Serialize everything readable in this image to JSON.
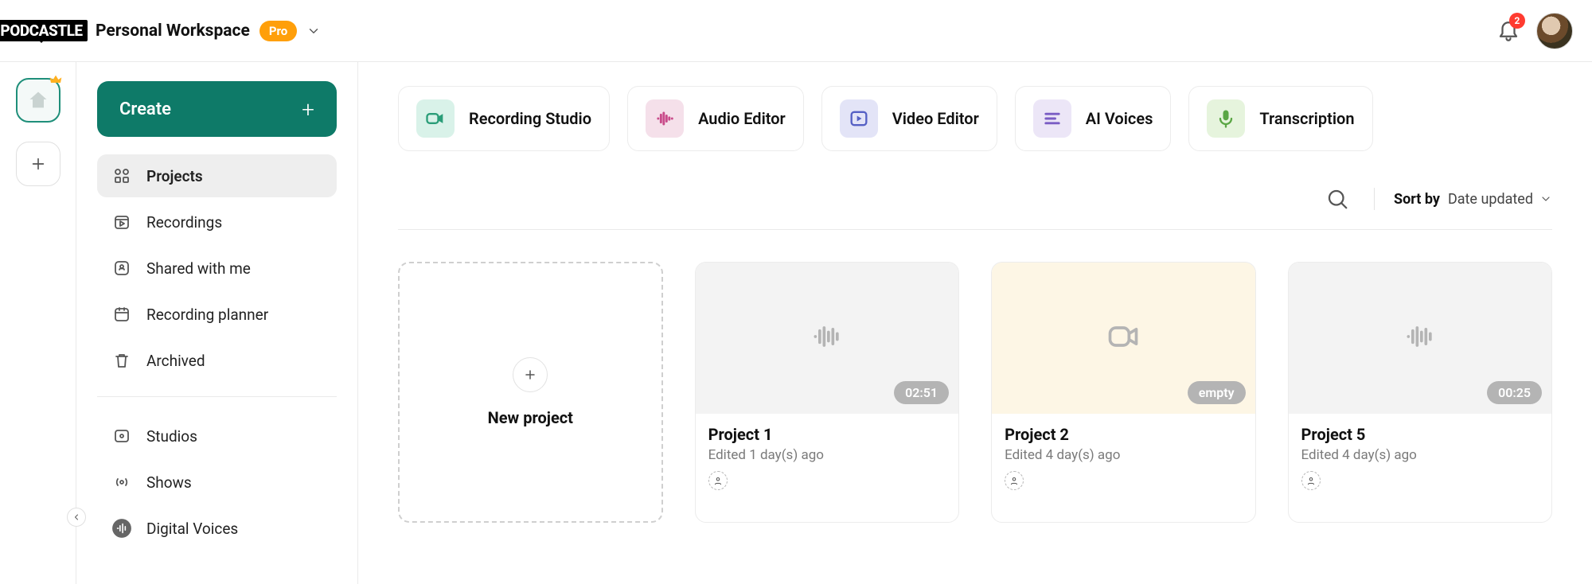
{
  "header": {
    "logo_text": "PODCASTLE",
    "workspace_name": "Personal Workspace",
    "badge": "Pro",
    "notifications_count": "2"
  },
  "sidebar": {
    "create_label": "Create",
    "items": [
      {
        "label": "Projects",
        "icon": "grid-icon",
        "active": true
      },
      {
        "label": "Recordings",
        "icon": "recordings-icon",
        "active": false
      },
      {
        "label": "Shared with me",
        "icon": "shared-icon",
        "active": false
      },
      {
        "label": "Recording planner",
        "icon": "calendar-icon",
        "active": false
      },
      {
        "label": "Archived",
        "icon": "trash-icon",
        "active": false
      }
    ],
    "items2": [
      {
        "label": "Studios",
        "icon": "studio-icon"
      },
      {
        "label": "Shows",
        "icon": "broadcast-icon"
      },
      {
        "label": "Digital Voices",
        "icon": "digital-voices-icon"
      }
    ]
  },
  "tools": [
    {
      "label": "Recording Studio",
      "color": "ic-rec",
      "icon": "video-camera-icon"
    },
    {
      "label": "Audio Editor",
      "color": "ic-aud",
      "icon": "waveform-icon"
    },
    {
      "label": "Video Editor",
      "color": "ic-vid",
      "icon": "video-play-icon"
    },
    {
      "label": "AI Voices",
      "color": "ic-ai",
      "icon": "ai-text-icon"
    },
    {
      "label": "Transcription",
      "color": "ic-tr",
      "icon": "mic-text-icon"
    }
  ],
  "sort": {
    "label": "Sort by",
    "value": "Date updated"
  },
  "new_project_label": "New project",
  "projects": [
    {
      "title": "Project 1",
      "subtitle": "Edited 1 day(s) ago",
      "badge": "02:51",
      "thumb": "audio",
      "bg": ""
    },
    {
      "title": "Project 2",
      "subtitle": "Edited 4 day(s) ago",
      "badge": "empty",
      "thumb": "video",
      "bg": "yellow"
    },
    {
      "title": "Project 5",
      "subtitle": "Edited 4 day(s) ago",
      "badge": "00:25",
      "thumb": "audio",
      "bg": ""
    }
  ]
}
